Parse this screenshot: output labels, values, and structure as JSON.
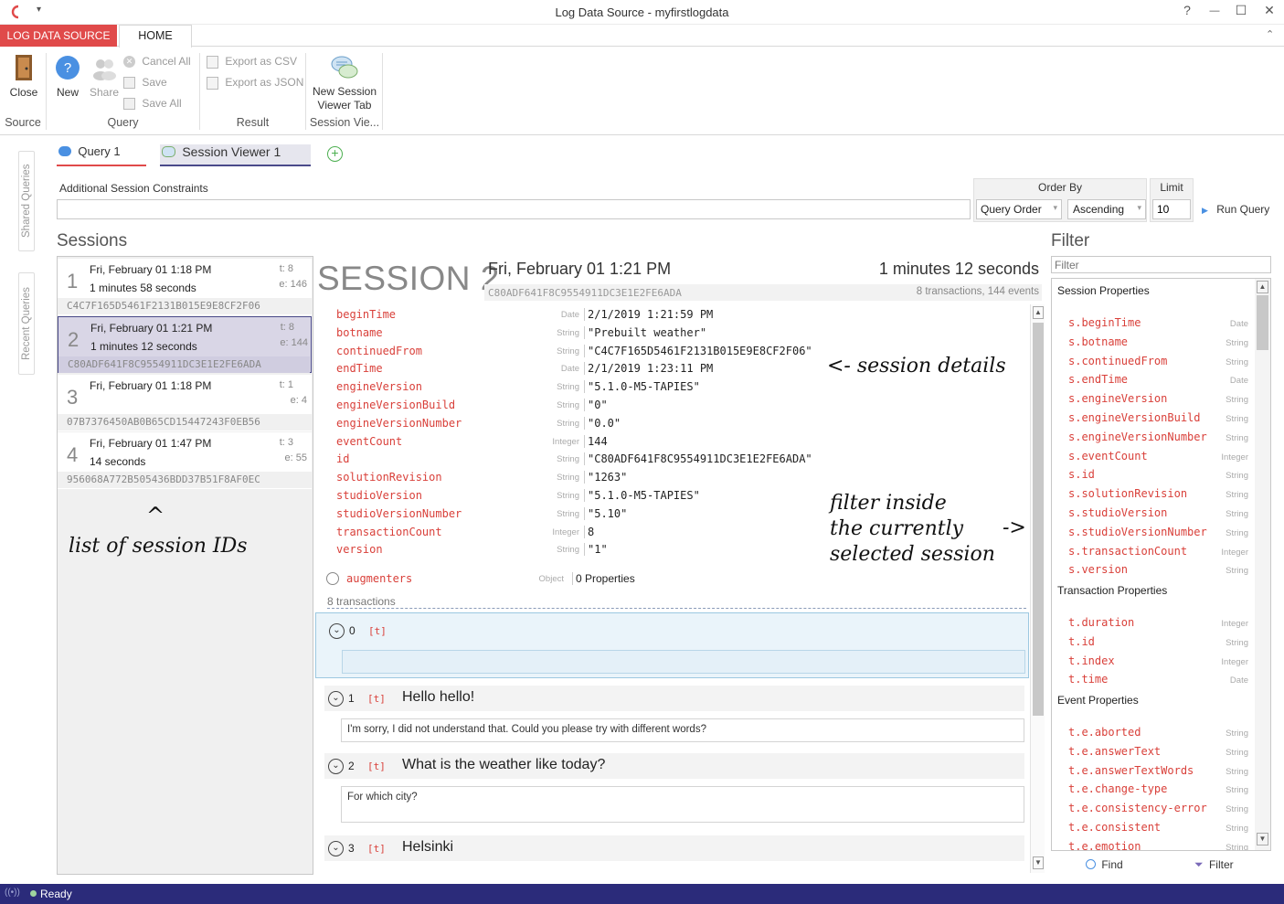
{
  "window": {
    "title": "Log Data Source - myfirstlogdata",
    "help": "?",
    "minimize": "—",
    "maximize": "☐",
    "close": "✕"
  },
  "ribbon": {
    "tab_source": "LOG DATA SOURCE",
    "tab_home": "HOME",
    "close": "Close",
    "new": "New",
    "share": "Share",
    "cancel_all": "Cancel All",
    "save": "Save",
    "save_all": "Save All",
    "export_csv": "Export as CSV",
    "export_json": "Export as JSON",
    "new_session_line1": "New Session",
    "new_session_line2": "Viewer Tab",
    "group_source": "Source",
    "group_query": "Query",
    "group_result": "Result",
    "group_session": "Session Vie..."
  },
  "sidebar": {
    "shared": "Shared Queries",
    "recent": "Recent Queries"
  },
  "doc_tabs": {
    "query": "Query 1",
    "session": "Session Viewer 1"
  },
  "constraints": {
    "label": "Additional Session Constraints",
    "value": ""
  },
  "order": {
    "label": "Order By",
    "field": "Query Order",
    "direction": "Ascending",
    "limit_label": "Limit",
    "limit": "10",
    "run": "Run Query"
  },
  "sessions": {
    "header": "Sessions",
    "items": [
      {
        "num": "1",
        "date": "Fri, February 01 1:18 PM",
        "duration": "1 minutes 58 seconds",
        "t": "t: 8",
        "e": "e: 146",
        "id": "C4C7F165D5461F2131B015E9E8CF2F06"
      },
      {
        "num": "2",
        "date": "Fri, February 01 1:21 PM",
        "duration": "1 minutes 12 seconds",
        "t": "t: 8",
        "e": "e: 144",
        "id": "C80ADF641F8C9554911DC3E1E2FE6ADA"
      },
      {
        "num": "3",
        "date": "Fri, February 01 1:18 PM",
        "duration": "",
        "t": "t: 1",
        "e": "e: 4",
        "id": "07B7376450AB0B65CD15447243F0EB56"
      },
      {
        "num": "4",
        "date": "Fri, February 01 1:47 PM",
        "duration": "14 seconds",
        "t": "t: 3",
        "e": "e: 55",
        "id": "956068A772B505436BDD37B51F8AF0EC"
      }
    ]
  },
  "session": {
    "title": "SESSION 2",
    "date": "Fri, February 01 1:21 PM",
    "duration": "1 minutes 12 seconds",
    "id": "C80ADF641F8C9554911DC3E1E2FE6ADA",
    "counts": "8 transactions, 144 events",
    "props": [
      {
        "name": "beginTime",
        "type": "Date",
        "value": "2/1/2019 1:21:59 PM"
      },
      {
        "name": "botname",
        "type": "String",
        "value": "\"Prebuilt weather\""
      },
      {
        "name": "continuedFrom",
        "type": "String",
        "value": "\"C4C7F165D5461F2131B015E9E8CF2F06\""
      },
      {
        "name": "endTime",
        "type": "Date",
        "value": "2/1/2019 1:23:11 PM"
      },
      {
        "name": "engineVersion",
        "type": "String",
        "value": "\"5.1.0-M5-TAPIES\""
      },
      {
        "name": "engineVersionBuild",
        "type": "String",
        "value": "\"0\""
      },
      {
        "name": "engineVersionNumber",
        "type": "String",
        "value": "\"0.0\""
      },
      {
        "name": "eventCount",
        "type": "Integer",
        "value": "144"
      },
      {
        "name": "id",
        "type": "String",
        "value": "\"C80ADF641F8C9554911DC3E1E2FE6ADA\""
      },
      {
        "name": "solutionRevision",
        "type": "String",
        "value": "\"1263\""
      },
      {
        "name": "studioVersion",
        "type": "String",
        "value": "\"5.1.0-M5-TAPIES\""
      },
      {
        "name": "studioVersionNumber",
        "type": "String",
        "value": "\"5.10\""
      },
      {
        "name": "transactionCount",
        "type": "Integer",
        "value": "8"
      },
      {
        "name": "version",
        "type": "String",
        "value": "\"1\""
      }
    ],
    "augmenters": {
      "name": "augmenters",
      "type": "Object",
      "value": "0 Properties"
    },
    "tx_label": "8 transactions",
    "transactions": [
      {
        "index": "0",
        "tag": "[t]",
        "input": "",
        "output": ""
      },
      {
        "index": "1",
        "tag": "[t]",
        "input": "Hello hello!",
        "output": "I'm sorry, I did not understand that. Could you please try with different words?"
      },
      {
        "index": "2",
        "tag": "[t]",
        "input": "What is the weather like today?",
        "output": "For which city?"
      },
      {
        "index": "3",
        "tag": "[t]",
        "input": "Helsinki",
        "output": ""
      }
    ]
  },
  "annotations": {
    "details": "<- session details",
    "ids": "list of session IDs",
    "arrow_up": "^",
    "filter_line1": "filter inside",
    "filter_line2": "the currently",
    "filter_line3": "selected session",
    "filter_arrow": "->"
  },
  "filter": {
    "header": "Filter",
    "placeholder": "Filter",
    "session_header": "Session Properties",
    "session_props": [
      {
        "name": "s.beginTime",
        "type": "Date"
      },
      {
        "name": "s.botname",
        "type": "String"
      },
      {
        "name": "s.continuedFrom",
        "type": "String"
      },
      {
        "name": "s.endTime",
        "type": "Date"
      },
      {
        "name": "s.engineVersion",
        "type": "String"
      },
      {
        "name": "s.engineVersionBuild",
        "type": "String"
      },
      {
        "name": "s.engineVersionNumber",
        "type": "String"
      },
      {
        "name": "s.eventCount",
        "type": "Integer"
      },
      {
        "name": "s.id",
        "type": "String"
      },
      {
        "name": "s.solutionRevision",
        "type": "String"
      },
      {
        "name": "s.studioVersion",
        "type": "String"
      },
      {
        "name": "s.studioVersionNumber",
        "type": "String"
      },
      {
        "name": "s.transactionCount",
        "type": "Integer"
      },
      {
        "name": "s.version",
        "type": "String"
      }
    ],
    "tx_header": "Transaction Properties",
    "tx_props": [
      {
        "name": "t.duration",
        "type": "Integer"
      },
      {
        "name": "t.id",
        "type": "String"
      },
      {
        "name": "t.index",
        "type": "Integer"
      },
      {
        "name": "t.time",
        "type": "Date"
      }
    ],
    "event_header": "Event Properties",
    "event_props": [
      {
        "name": "t.e.aborted",
        "type": "String"
      },
      {
        "name": "t.e.answerText",
        "type": "String"
      },
      {
        "name": "t.e.answerTextWords",
        "type": "String"
      },
      {
        "name": "t.e.change-type",
        "type": "String"
      },
      {
        "name": "t.e.consistency-error",
        "type": "String"
      },
      {
        "name": "t.e.consistent",
        "type": "String"
      },
      {
        "name": "t.e.emotion",
        "type": "String"
      }
    ],
    "find": "Find",
    "filter_btn": "Filter"
  },
  "status": {
    "text": "Ready"
  },
  "colors": {
    "accent_red": "#e04a4a",
    "status_bar": "#2b2b7a",
    "selection": "#d9d6e6"
  }
}
